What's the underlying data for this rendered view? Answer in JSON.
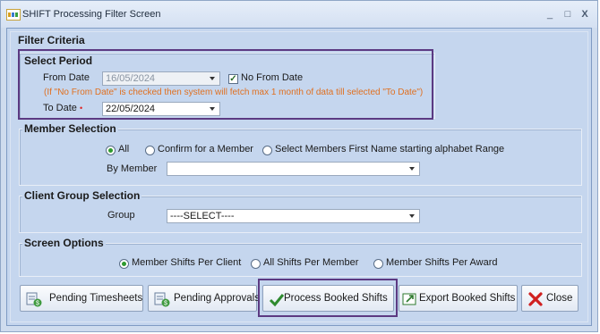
{
  "window": {
    "title": "SHIFT Processing Filter Screen",
    "app_icon": "shift-logo-icon",
    "controls": {
      "minimize": "_",
      "maximize": "□",
      "close": "X"
    }
  },
  "filter_criteria": {
    "legend": "Filter Criteria",
    "select_period": {
      "legend": "Select Period",
      "from_date_label": "From Date",
      "from_date_value": "16/05/2024",
      "no_from_date_label": "No From Date",
      "no_from_date_checked": true,
      "hint": "(If \"No From Date\" is checked then system will fetch max 1 month of data till selected \"To Date\")",
      "to_date_label": "To Date",
      "required_mark": "•",
      "to_date_value": "22/05/2024"
    },
    "member_selection": {
      "legend": "Member Selection",
      "options": [
        "All",
        "Confirm for a Member",
        "Select Members First Name starting alphabet Range"
      ],
      "selected": "All",
      "by_member_label": "By Member",
      "by_member_value": ""
    },
    "client_group_selection": {
      "legend": "Client Group Selection",
      "group_label": "Group",
      "group_value": "----SELECT----"
    },
    "screen_options": {
      "legend": "Screen Options",
      "options": [
        "Member Shifts Per Client",
        "All Shifts Per Member",
        "Member Shifts Per Award"
      ],
      "selected": "Member Shifts Per Client"
    }
  },
  "buttons": {
    "pending_timesheets": "Pending Timesheets",
    "pending_approvals": "Pending Approvals",
    "process_booked_shifts": "Process Booked Shifts",
    "export_booked_shifts": "Export Booked Shifts",
    "close": "Close"
  },
  "colors": {
    "highlight_border": "#5c3a82",
    "hint_text": "#e07020",
    "required": "#e02020",
    "radio_selected": "#2e9a2e"
  }
}
